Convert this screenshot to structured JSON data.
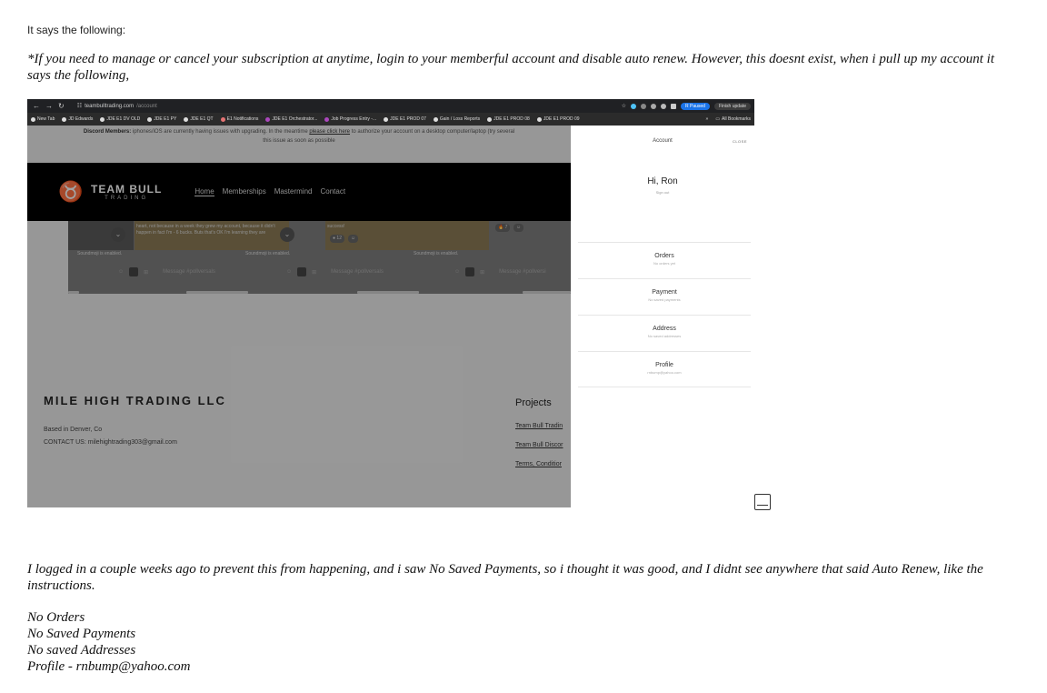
{
  "intro": "It says the following:",
  "quote": "*If you need to manage or cancel your subscription at anytime, login to your memberful account and disable auto renew.  However, this doesnt exist, when i pull up my account it says the following,",
  "screenshot": {
    "browser": {
      "url_host": "teambulltrading.com",
      "url_path": "/account",
      "paused": "Paused",
      "profile_initial": "R",
      "finish_update": "Finish update",
      "bookmarks": [
        "New Tab",
        "JD Edwards",
        "JDE E1 DV OLD",
        "JDE E1 PY",
        "JDE E1 QT",
        "E1 Notifications",
        "JDE E1 Orchestrator...",
        "Job Progress Entry -...",
        "JDE E1 PROD 07",
        "Gain / Loss Reports",
        "JDE E1 PROD 08",
        "JDE E1 PROD 09"
      ],
      "more": "»",
      "all_bookmarks": "All Bookmarks"
    },
    "banner": {
      "bold": "Discord Members:",
      "text": " iphones/iOS are currently having issues with upgrading. In the meantime ",
      "link": "please click here",
      "text2": " to authorize your account on a desktop computer/laptop (try several",
      "line2": "this issue as soon as possible"
    },
    "site": {
      "logo_main": "TEAM BULL",
      "logo_sub": "TRADING",
      "menu": [
        "Home",
        "Memberships",
        "Mastermind",
        "Contact"
      ]
    },
    "discord": {
      "msg1": "heart, not because in a week they grew my account, because it didn't happen in fact I'm - 6 bucks. Buts that's OK I'm learning they are",
      "msg2": "success!",
      "react1": "12",
      "react2": "7",
      "sound": "Soundmoji is enabled.",
      "message_placeholder": "Message #pollversals",
      "message_placeholder2": "Message #pollversals",
      "message_placeholder3": "Message #pollversi"
    },
    "footer": {
      "company": "MILE HIGH TRADING LLC",
      "based": "Based in Denver, Co",
      "contact": "CONTACT US: milehightrading303@gmail.com",
      "projects_title": "Projects",
      "links": [
        "Team Bull Tradin",
        "Team Bull Discor",
        "Terms, Conditior"
      ]
    },
    "panel": {
      "title": "Account",
      "close": "CLOSE",
      "greeting": "Hi, Ron",
      "signout": "Sign out",
      "items": [
        {
          "label": "Orders",
          "sub": "No orders yet"
        },
        {
          "label": "Payment",
          "sub": "No saved payments"
        },
        {
          "label": "Address",
          "sub": "No saved addresses"
        },
        {
          "label": "Profile",
          "sub": "rnbump@yahoo.com"
        }
      ]
    }
  },
  "para": "I logged in a couple weeks ago to prevent this from happening, and i saw  No Saved Payments, so i thought it was good, and I didnt see anywhere that said Auto Renew, like the instructions.",
  "list": [
    "No Orders",
    "No Saved Payments",
    "No saved Addresses",
    "Profile - rnbump@yahoo.com"
  ]
}
